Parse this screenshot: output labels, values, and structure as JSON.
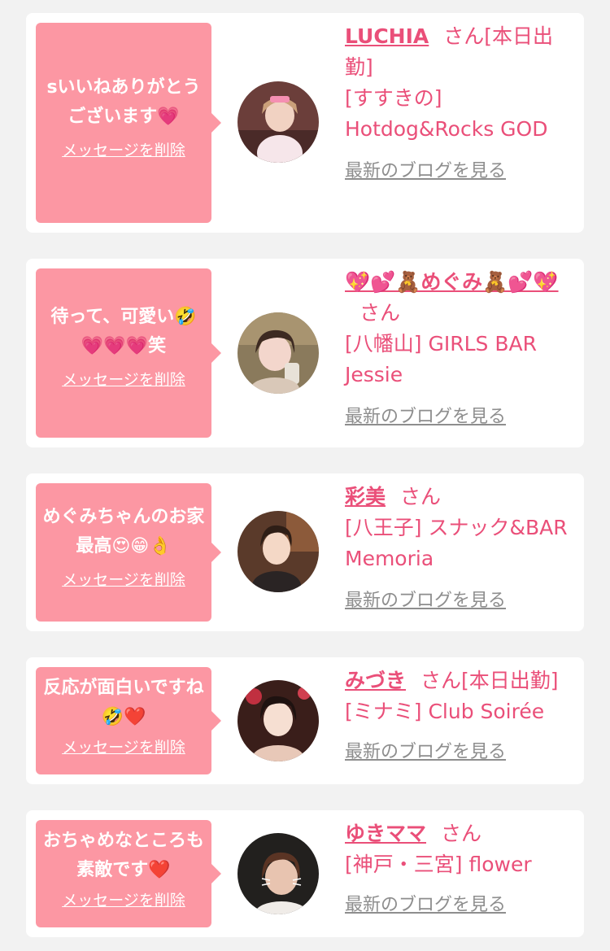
{
  "delete_label": "メッセージを削除",
  "blog_label": "最新のブログを見る",
  "san": "さん",
  "colors": {
    "background": "#f2f2f2",
    "bubble": "#fc97a3",
    "accent": "#ea4f79",
    "link_gray": "#8e8e8e"
  },
  "items": [
    {
      "message": "sいいねありがとうございます💗",
      "name": "LUCHIA",
      "status": "[本日出勤]",
      "shop": "[すすきの] Hotdog&Rocks GOD",
      "avatar": "avatar-photo-1"
    },
    {
      "message": "待って、可愛い🤣💗💗💗笑",
      "name": "💖💕🧸めぐみ🧸💕💖",
      "status": "",
      "shop": "[八幡山] GIRLS BAR Jessie",
      "avatar": "avatar-photo-2"
    },
    {
      "message": "めぐみちゃんのお家　最高😍😁👌",
      "name": "彩美",
      "status": "",
      "shop": "[八王子] スナック&BAR Memoria",
      "avatar": "avatar-photo-3"
    },
    {
      "message": "反応が面白いですね🤣❤️",
      "name": "みづき",
      "status": "[本日出勤]",
      "shop": "[ミナミ] Club Soirée",
      "avatar": "avatar-photo-4"
    },
    {
      "message": "おちゃめなところも素敵です❤️",
      "name": "ゆきママ",
      "status": "",
      "shop": "[神戸・三宮] flower",
      "avatar": "avatar-photo-5"
    }
  ]
}
